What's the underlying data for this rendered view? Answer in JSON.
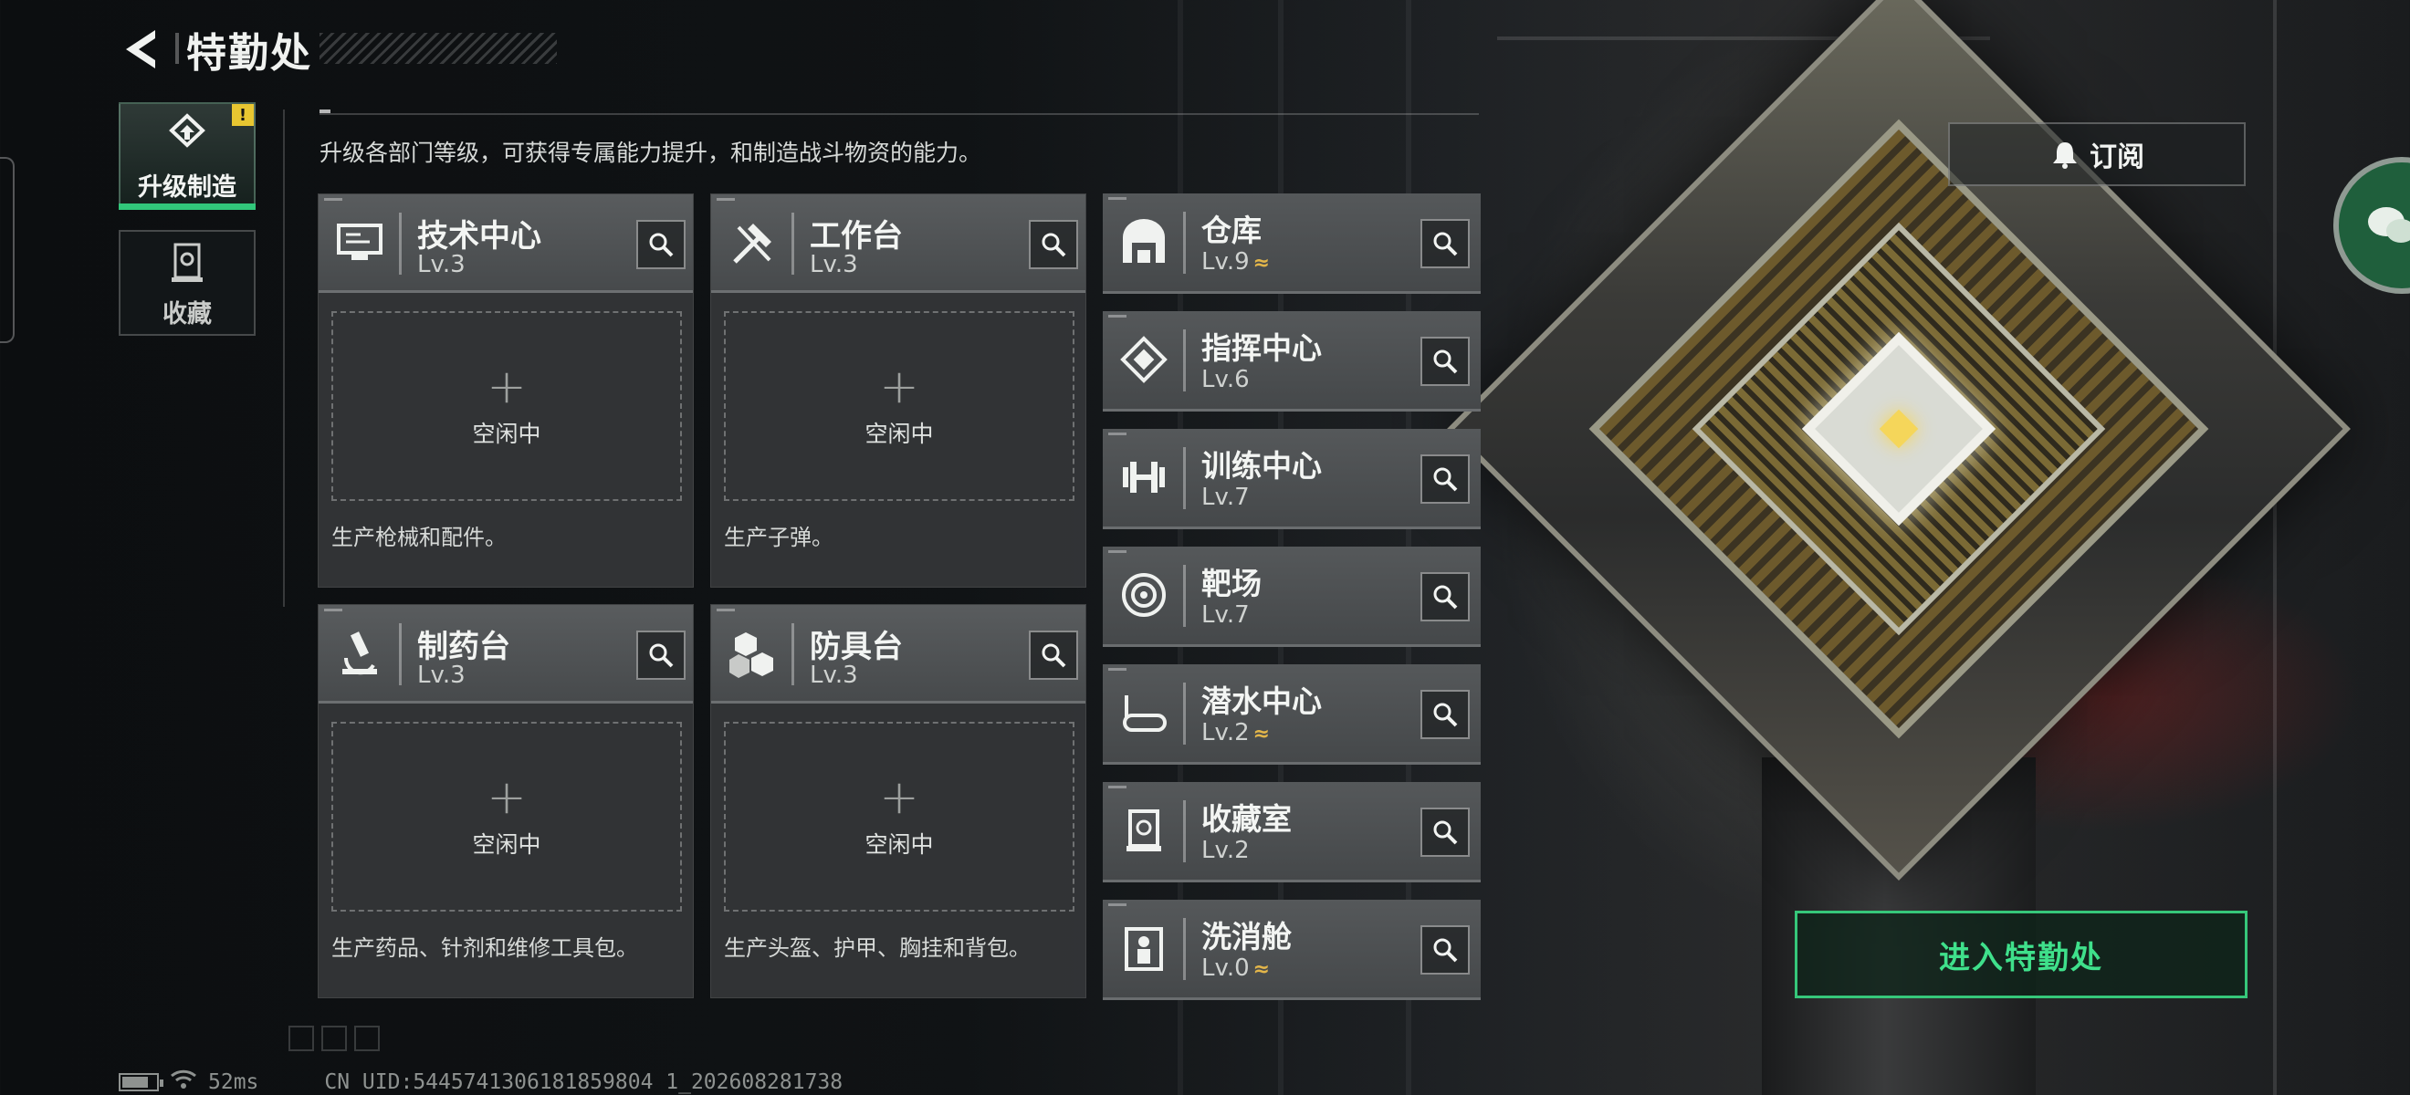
{
  "header": {
    "title": "特勤处"
  },
  "sidebar": {
    "items": [
      {
        "label": "升级制造",
        "active": true,
        "badge": "!"
      },
      {
        "label": "收藏",
        "active": false
      }
    ]
  },
  "description": "升级各部门等级，可获得专属能力提升，和制造战斗物资的能力。",
  "production_cards": [
    {
      "name": "技术中心",
      "level": "Lv.3",
      "slot_label": "+",
      "slot_status": "空闲中",
      "desc": "生产枪械和配件。",
      "icon": "computer-icon"
    },
    {
      "name": "工作台",
      "level": "Lv.3",
      "slot_label": "+",
      "slot_status": "空闲中",
      "desc": "生产子弹。",
      "icon": "tools-icon"
    },
    {
      "name": "制药台",
      "level": "Lv.3",
      "slot_label": "+",
      "slot_status": "空闲中",
      "desc": "生产药品、针剂和维修工具包。",
      "icon": "microscope-icon"
    },
    {
      "name": "防具台",
      "level": "Lv.3",
      "slot_label": "+",
      "slot_status": "空闲中",
      "desc": "生产头盔、护甲、胸挂和背包。",
      "icon": "boxes-icon"
    }
  ],
  "facilities": [
    {
      "name": "仓库",
      "level": "Lv.9",
      "upgradeable": true,
      "icon": "warehouse-icon"
    },
    {
      "name": "指挥中心",
      "level": "Lv.6",
      "upgradeable": false,
      "icon": "chip-icon"
    },
    {
      "name": "训练中心",
      "level": "Lv.7",
      "upgradeable": false,
      "icon": "dumbbell-icon"
    },
    {
      "name": "靶场",
      "level": "Lv.7",
      "upgradeable": false,
      "icon": "target-icon"
    },
    {
      "name": "潜水中心",
      "level": "Lv.2",
      "upgradeable": true,
      "icon": "diving-mask-icon"
    },
    {
      "name": "收藏室",
      "level": "Lv.2",
      "upgradeable": false,
      "icon": "collection-icon"
    },
    {
      "name": "洗消舱",
      "level": "Lv.0",
      "upgradeable": true,
      "icon": "decon-icon"
    }
  ],
  "upgrade_marker": "≈",
  "subscribe_label": "订阅",
  "enter_label": "进入特勤处",
  "status": {
    "ping": "52ms",
    "uid": "CN UID:5445741306181859804 1_202608281738",
    "battery_level": 0.8
  },
  "colors": {
    "accent_green": "#36c77a",
    "upgrade_gold": "#e3b64a",
    "warning_yellow": "#e8c631"
  }
}
